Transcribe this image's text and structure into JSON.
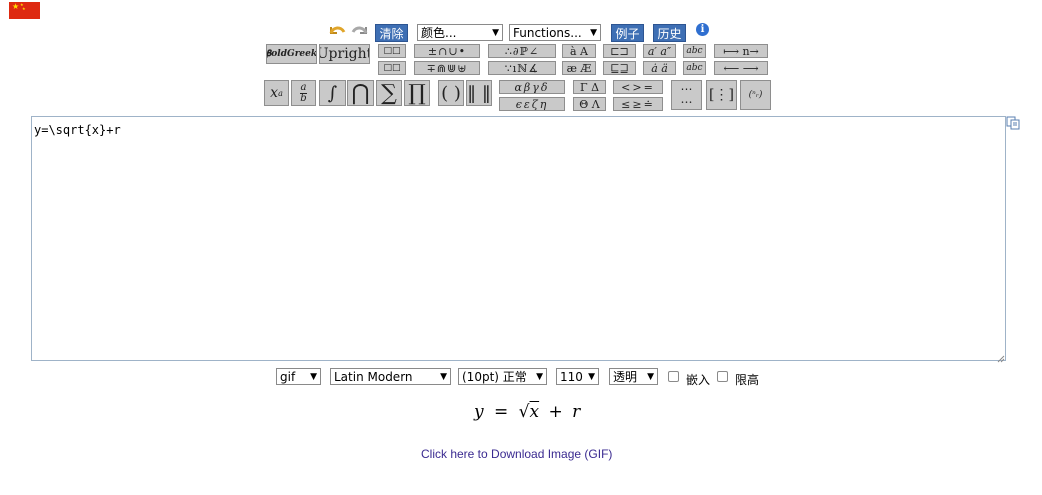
{
  "flag": {
    "name": "china-flag-icon"
  },
  "toolbar": {
    "clear_label": "清除",
    "color_select": "颜色...",
    "functions_select": "Functions...",
    "examples_label": "例子",
    "history_label": "历史",
    "boldgreek_label": "𝛃oldGreek",
    "upright_label": "Upright"
  },
  "editor": {
    "value": "y=\\sqrt{x}+r"
  },
  "options": {
    "format": "gif",
    "font": "Latin Modern",
    "size": "(10pt) 正常",
    "dpi": "110",
    "background": "透明",
    "embed_label": "嵌入",
    "inline_label": "限高"
  },
  "preview": {
    "lhs": "y",
    "eq": "=",
    "rad": "√",
    "x": "x",
    "plus": "+",
    "r": "r"
  },
  "download": {
    "label": "Click here to Download Image (GIF)"
  },
  "colors": {
    "accent": "#3e6fb4",
    "link": "#3a2a90",
    "toolbar_bg": "#c9c9c9",
    "flag": "#de2910"
  }
}
